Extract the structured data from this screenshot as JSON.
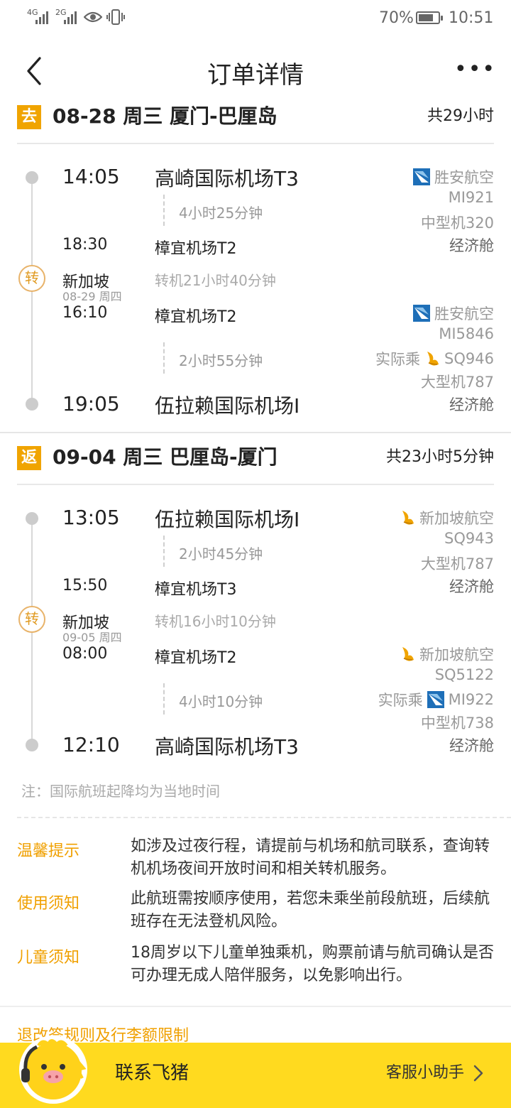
{
  "status_bar": {
    "net1": "4G",
    "net2": "2G",
    "battery": "70%",
    "time": "10:51"
  },
  "header": {
    "title": "订单详情",
    "more": "•••"
  },
  "outbound": {
    "badge": "去",
    "title": "08-28 周三 厦门-巴厘岛",
    "total": "共29小时",
    "leg1": {
      "dep_time": "14:05",
      "dep_airport": "高崎国际机场T3",
      "duration": "4小时25分钟",
      "arr_time": "18:30",
      "arr_airport": "樟宜机场T2",
      "airline": "胜安航空",
      "flight": "MI921",
      "aircraft": "中型机320",
      "cabin": "经济舱"
    },
    "transfer": {
      "icon": "转",
      "city": "新加坡",
      "date": "08-29 周四",
      "text": "转机21小时40分钟"
    },
    "leg2": {
      "dep_time": "16:10",
      "dep_airport": "樟宜机场T2",
      "duration": "2小时55分钟",
      "arr_time": "19:05",
      "arr_airport": "伍拉赖国际机场I",
      "airline": "胜安航空",
      "flight": "MI5846",
      "actual_label": "实际乘",
      "actual_flight": "SQ946",
      "aircraft": "大型机787",
      "cabin": "经济舱"
    }
  },
  "return": {
    "badge": "返",
    "title": "09-04 周三 巴厘岛-厦门",
    "total": "共23小时5分钟",
    "leg1": {
      "dep_time": "13:05",
      "dep_airport": "伍拉赖国际机场I",
      "duration": "2小时45分钟",
      "arr_time": "15:50",
      "arr_airport": "樟宜机场T3",
      "airline": "新加坡航空",
      "flight": "SQ943",
      "aircraft": "大型机787",
      "cabin": "经济舱"
    },
    "transfer": {
      "icon": "转",
      "city": "新加坡",
      "date": "09-05 周四",
      "text": "转机16小时10分钟"
    },
    "leg2": {
      "dep_time": "08:00",
      "dep_airport": "樟宜机场T2",
      "duration": "4小时10分钟",
      "arr_time": "12:10",
      "arr_airport": "高崎国际机场T3",
      "airline": "新加坡航空",
      "flight": "SQ5122",
      "actual_label": "实际乘",
      "actual_flight": "MI922",
      "aircraft": "中型机738",
      "cabin": "经济舱"
    }
  },
  "note": "注：国际航班起降均为当地时间",
  "tips": [
    {
      "label": "温馨提示",
      "text": "如涉及过夜行程，请提前与机场和航司联系，查询转机机场夜间开放时间和相关转机服务。"
    },
    {
      "label": "使用须知",
      "text": "此航班需按顺序使用，若您未乘坐前段航班，后续航班存在无法登机风险。"
    },
    {
      "label": "儿童须知",
      "text": "18周岁以下儿童单独乘机，购票前请与航司确认是否可办理无成人陪伴服务，以免影响出行。"
    }
  ],
  "rules_link": "退改签规则及行李额限制",
  "bottom_bar": {
    "contact": "联系飞猪",
    "helper": "客服小助手"
  },
  "colors": {
    "accent": "#f0a400",
    "bottom_bar": "#ffda1f",
    "muted_text": "#999999"
  }
}
